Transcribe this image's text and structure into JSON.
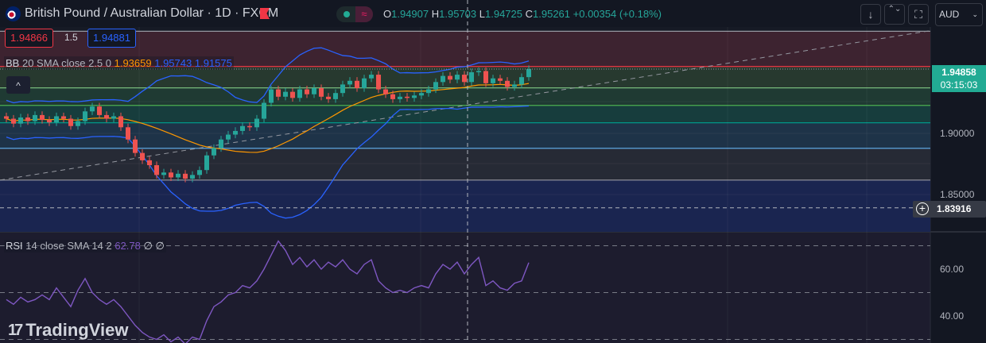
{
  "header": {
    "title": "British Pound / Australian Dollar · 1D · FXCM",
    "ohlc": {
      "o_label": "O",
      "o": "1.94907",
      "h_label": "H",
      "h": "1.95703",
      "l_label": "L",
      "l": "1.94725",
      "c_label": "C",
      "c": "1.95261",
      "change": "+0.00354 (+0.18%)"
    }
  },
  "toolbar": {
    "down_icon": "↓",
    "collapse_icon": "⌃⌄",
    "fullscreen_icon": "⛶",
    "currency": "AUD"
  },
  "trade": {
    "sell": "1.94866",
    "spread": "1.5",
    "buy": "1.94881"
  },
  "bb_legend": {
    "label": "BB",
    "params": "20 SMA close 2.5 0",
    "basis": "1.93659",
    "upper": "1.95743",
    "lower": "1.91575"
  },
  "rsi_legend": {
    "label": "RSI",
    "params": "14 close SMA 14 2",
    "value": "62.78",
    "extra1": "∅",
    "extra2": "∅"
  },
  "price_axis": {
    "labels": [
      "1.90000",
      "1.85000"
    ],
    "last_price": "1.94858",
    "countdown": "03:15:03",
    "crosshair_price": "1.83916"
  },
  "rsi_axis": {
    "labels": [
      "60.00",
      "40.00"
    ]
  },
  "logo": "TradingView",
  "colors": {
    "up": "#26a69a",
    "down": "#ef5350",
    "bb": "#2962ff",
    "basis": "#ff9800",
    "rsi": "#7e57c2",
    "accent": "#22ab94"
  },
  "chart_data": {
    "type": "candlestick",
    "title": "British Pound / Australian Dollar · 1D · FXCM",
    "ylim": [
      1.82,
      1.985
    ],
    "closes": [
      1.912,
      1.908,
      1.913,
      1.91,
      1.915,
      1.911,
      1.909,
      1.914,
      1.912,
      1.906,
      1.91,
      1.918,
      1.922,
      1.915,
      1.912,
      1.914,
      1.905,
      1.895,
      1.884,
      1.878,
      1.874,
      1.866,
      1.868,
      1.864,
      1.867,
      1.863,
      1.866,
      1.87,
      1.882,
      1.888,
      1.895,
      1.899,
      1.902,
      1.906,
      1.905,
      1.912,
      1.925,
      1.936,
      1.93,
      1.934,
      1.929,
      1.936,
      1.932,
      1.937,
      1.93,
      1.928,
      1.933,
      1.94,
      1.943,
      1.937,
      1.945,
      1.948,
      1.936,
      1.932,
      1.928,
      1.93,
      1.929,
      1.931,
      1.933,
      1.936,
      1.942,
      1.947,
      1.944,
      1.948,
      1.942,
      1.95,
      1.951,
      1.941,
      1.945,
      1.943,
      1.938,
      1.94,
      1.946,
      1.9526
    ],
    "zones": [
      1.9835,
      1.9547,
      1.9372,
      1.9229,
      1.9087,
      1.8878,
      1.8618
    ],
    "trendline": {
      "from": 1.8618,
      "to": 1.984
    },
    "rsi": {
      "ylim": [
        25,
        75
      ],
      "levels": [
        70,
        50,
        30
      ],
      "values": [
        47,
        45,
        48,
        46,
        47,
        49,
        47,
        52,
        48,
        44,
        51,
        56,
        50,
        47,
        45,
        47,
        44,
        40,
        36,
        33,
        31,
        30,
        32,
        29,
        31,
        28,
        31,
        30,
        38,
        44,
        46,
        49,
        50,
        53,
        52,
        55,
        60,
        66,
        72,
        68,
        62,
        65,
        61,
        64,
        60,
        63,
        61,
        64,
        60,
        58,
        62,
        64,
        55,
        52,
        50,
        51,
        50,
        52,
        53,
        52,
        58,
        62,
        60,
        63,
        58,
        62,
        65,
        53,
        55,
        52,
        51,
        54,
        55,
        62.78
      ]
    },
    "crosshair_price": 1.83916
  }
}
